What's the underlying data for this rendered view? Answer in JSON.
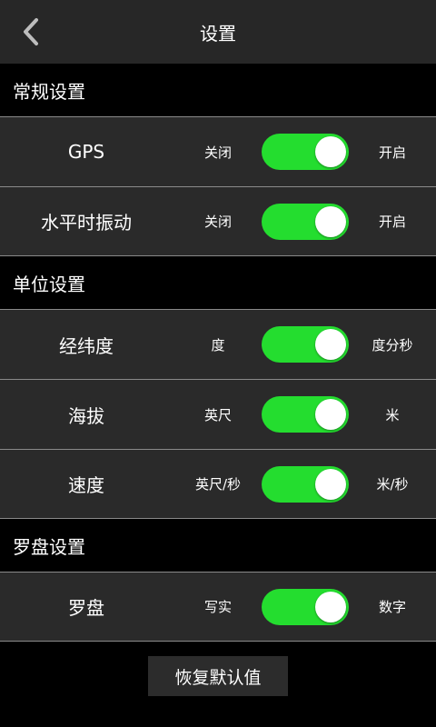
{
  "header": {
    "title": "设置",
    "back_icon": "chevron-left-icon"
  },
  "colors": {
    "toggle_on": "#24dd2f",
    "row_bg": "#2a2a2a",
    "header_bg": "#272727"
  },
  "sections": [
    {
      "title": "常规设置",
      "rows": [
        {
          "label": "GPS",
          "left": "关闭",
          "right": "开启",
          "on": true
        },
        {
          "label": "水平时振动",
          "left": "关闭",
          "right": "开启",
          "on": true
        }
      ]
    },
    {
      "title": "单位设置",
      "rows": [
        {
          "label": "经纬度",
          "left": "度",
          "right": "度分秒",
          "on": true
        },
        {
          "label": "海拔",
          "left": "英尺",
          "right": "米",
          "on": true
        },
        {
          "label": "速度",
          "left": "英尺/秒",
          "right": "米/秒",
          "on": true
        }
      ]
    },
    {
      "title": "罗盘设置",
      "rows": [
        {
          "label": "罗盘",
          "left": "写实",
          "right": "数字",
          "on": true
        }
      ]
    }
  ],
  "footer": {
    "reset_label": "恢复默认值"
  }
}
